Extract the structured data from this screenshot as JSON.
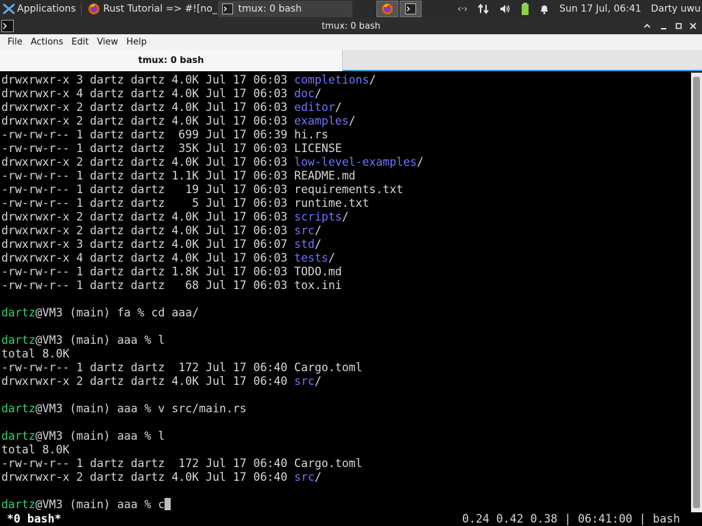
{
  "panel": {
    "applications_label": "Applications",
    "tasks": [
      {
        "label": "Rust Tutorial => #![no_..."
      },
      {
        "label": "tmux: 0 bash"
      }
    ],
    "clock": "Sun 17 Jul, 06:41",
    "user": "Darty uwu"
  },
  "window": {
    "title": "tmux: 0 bash"
  },
  "menubar": {
    "items": [
      "File",
      "Actions",
      "Edit",
      "View",
      "Help"
    ]
  },
  "tab": {
    "label": "tmux: 0 bash"
  },
  "terminal": {
    "lines": [
      {
        "pre": "drwxrwxr-x 3 dartz dartz 4.0K Jul 17 06:03 ",
        "name": "completions",
        "dir": true
      },
      {
        "pre": "drwxrwxr-x 4 dartz dartz 4.0K Jul 17 06:03 ",
        "name": "doc",
        "dir": true
      },
      {
        "pre": "drwxrwxr-x 2 dartz dartz 4.0K Jul 17 06:03 ",
        "name": "editor",
        "dir": true
      },
      {
        "pre": "drwxrwxr-x 2 dartz dartz 4.0K Jul 17 06:03 ",
        "name": "examples",
        "dir": true
      },
      {
        "pre": "-rw-rw-r-- 1 dartz dartz  699 Jul 17 06:39 ",
        "name": "hi.rs",
        "dir": false
      },
      {
        "pre": "-rw-rw-r-- 1 dartz dartz  35K Jul 17 06:03 ",
        "name": "LICENSE",
        "dir": false
      },
      {
        "pre": "drwxrwxr-x 2 dartz dartz 4.0K Jul 17 06:03 ",
        "name": "low-level-examples",
        "dir": true
      },
      {
        "pre": "-rw-rw-r-- 1 dartz dartz 1.1K Jul 17 06:03 ",
        "name": "README.md",
        "dir": false
      },
      {
        "pre": "-rw-rw-r-- 1 dartz dartz   19 Jul 17 06:03 ",
        "name": "requirements.txt",
        "dir": false
      },
      {
        "pre": "-rw-rw-r-- 1 dartz dartz    5 Jul 17 06:03 ",
        "name": "runtime.txt",
        "dir": false
      },
      {
        "pre": "drwxrwxr-x 2 dartz dartz 4.0K Jul 17 06:03 ",
        "name": "scripts",
        "dir": true
      },
      {
        "pre": "drwxrwxr-x 2 dartz dartz 4.0K Jul 17 06:03 ",
        "name": "src",
        "dir": true
      },
      {
        "pre": "drwxrwxr-x 3 dartz dartz 4.0K Jul 17 06:07 ",
        "name": "std",
        "dir": true
      },
      {
        "pre": "drwxrwxr-x 4 dartz dartz 4.0K Jul 17 06:03 ",
        "name": "tests",
        "dir": true
      },
      {
        "pre": "-rw-rw-r-- 1 dartz dartz 1.8K Jul 17 06:03 ",
        "name": "TODO.md",
        "dir": false
      },
      {
        "pre": "-rw-rw-r-- 1 dartz dartz   68 Jul 17 06:03 ",
        "name": "tox.ini",
        "dir": false
      },
      {
        "blank": true
      },
      {
        "prompt_user": "dartz",
        "prompt_rest": "@VM3 (main) fa % cd aaa/"
      },
      {
        "blank": true
      },
      {
        "prompt_user": "dartz",
        "prompt_rest": "@VM3 (main) aaa % l"
      },
      {
        "text": "total 8.0K"
      },
      {
        "pre": "-rw-rw-r-- 1 dartz dartz  172 Jul 17 06:40 ",
        "name": "Cargo.toml",
        "dir": false
      },
      {
        "pre": "drwxrwxr-x 2 dartz dartz 4.0K Jul 17 06:40 ",
        "name": "src",
        "dir": true
      },
      {
        "blank": true
      },
      {
        "prompt_user": "dartz",
        "prompt_rest": "@VM3 (main) aaa % v src/main.rs"
      },
      {
        "blank": true
      },
      {
        "prompt_user": "dartz",
        "prompt_rest": "@VM3 (main) aaa % l"
      },
      {
        "text": "total 8.0K"
      },
      {
        "pre": "-rw-rw-r-- 1 dartz dartz  172 Jul 17 06:40 ",
        "name": "Cargo.toml",
        "dir": false
      },
      {
        "pre": "drwxrwxr-x 2 dartz dartz 4.0K Jul 17 06:40 ",
        "name": "src",
        "dir": true
      },
      {
        "blank": true
      },
      {
        "prompt_user": "dartz",
        "prompt_rest": "@VM3 (main) aaa % c",
        "cursor": true
      }
    ]
  },
  "tmux_status": {
    "left": "*0 bash*",
    "right": "0.24 0.42 0.38 | 06:41:00 | bash"
  },
  "colors": {
    "directory": "#6f74ff",
    "prompt_user": "#36d36d",
    "accent": "#3a9bd5"
  }
}
